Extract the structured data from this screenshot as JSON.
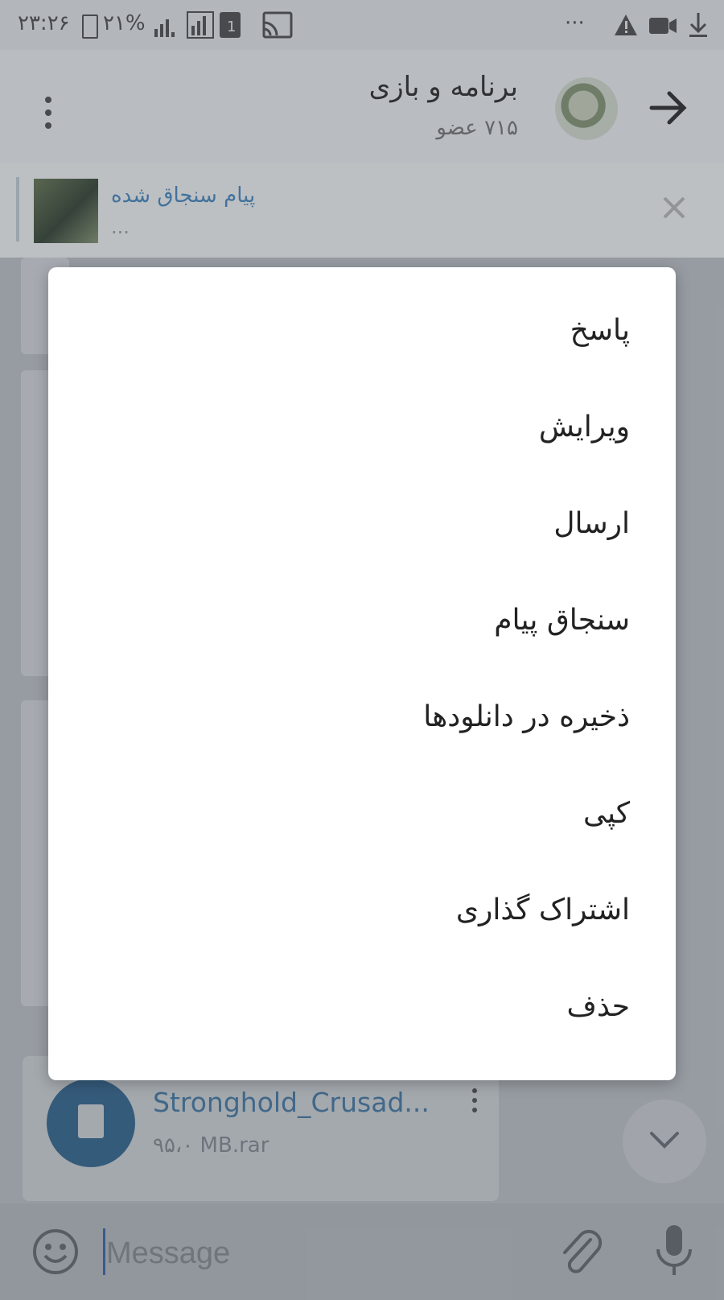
{
  "status_bar": {
    "time": "۲۳:۲۶",
    "battery": "۲۱%",
    "more": "···"
  },
  "header": {
    "title": "برنامه و بازی",
    "subtitle": "۷۱۵ عضو"
  },
  "pinned": {
    "label": "پیام سنجاق شده",
    "text": "..."
  },
  "file_message": {
    "name": "Stronghold_Crusad...",
    "size": "۹۵،۰ MB.rar"
  },
  "context_menu": {
    "items": [
      "پاسخ",
      "ویرایش",
      "ارسال",
      "سنجاق پیام",
      "ذخیره در دانلودها",
      "کپی",
      "اشتراک گذاری",
      "حذف"
    ]
  },
  "input": {
    "placeholder": "Message"
  },
  "colors": {
    "accent": "#4b7fa8",
    "file_icon_bg": "#3b6c95",
    "menu_bg": "#ffffff"
  }
}
